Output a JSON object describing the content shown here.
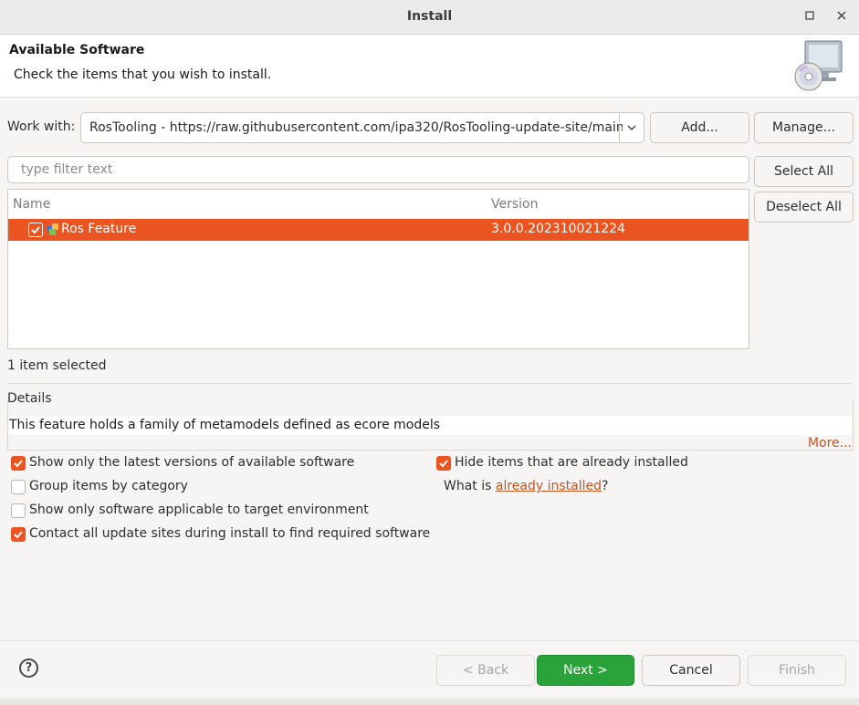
{
  "window": {
    "title": "Install",
    "minimize_icon": "minimize-icon",
    "close_icon": "close-icon"
  },
  "header": {
    "title": "Available Software",
    "subtitle": "Check the items that you wish to install.",
    "icon": "install-cd-monitor-icon"
  },
  "work_with": {
    "label": "Work with:",
    "value": "RosTooling - https://raw.githubusercontent.com/ipa320/RosTooling-update-site/main",
    "add_button": "Add...",
    "manage_button": "Manage..."
  },
  "filter": {
    "placeholder": "type filter text",
    "value": ""
  },
  "side_buttons": {
    "select_all": "Select All",
    "deselect_all": "Deselect All"
  },
  "table": {
    "columns": [
      "Name",
      "Version"
    ],
    "rows": [
      {
        "checked": true,
        "name": "Ros Feature",
        "version": "3.0.0.202310021224",
        "selected": true
      }
    ]
  },
  "selection_status": "1 item selected",
  "details": {
    "label": "Details",
    "text": "This feature holds a family of metamodels defined as ecore models",
    "more_link": "More..."
  },
  "options": {
    "show_latest": {
      "label": "Show only the latest versions of available software",
      "checked": true
    },
    "group_by_category": {
      "label": "Group items by category",
      "checked": false
    },
    "show_applicable": {
      "label": "Show only software applicable to target environment",
      "checked": false
    },
    "contact_update_sites": {
      "label": "Contact all update sites during install to find required software",
      "checked": true
    },
    "hide_installed": {
      "label": "Hide items that are already installed",
      "checked": true
    },
    "what_is_prefix": "What is ",
    "already_installed_link": "already installed",
    "what_is_suffix": "?"
  },
  "footer": {
    "help_icon": "help-icon",
    "back": "< Back",
    "next": "Next >",
    "cancel": "Cancel",
    "finish": "Finish"
  },
  "colors": {
    "accent": "#e95420",
    "primary_button": "#2aa33a",
    "link": "#c7541e"
  }
}
